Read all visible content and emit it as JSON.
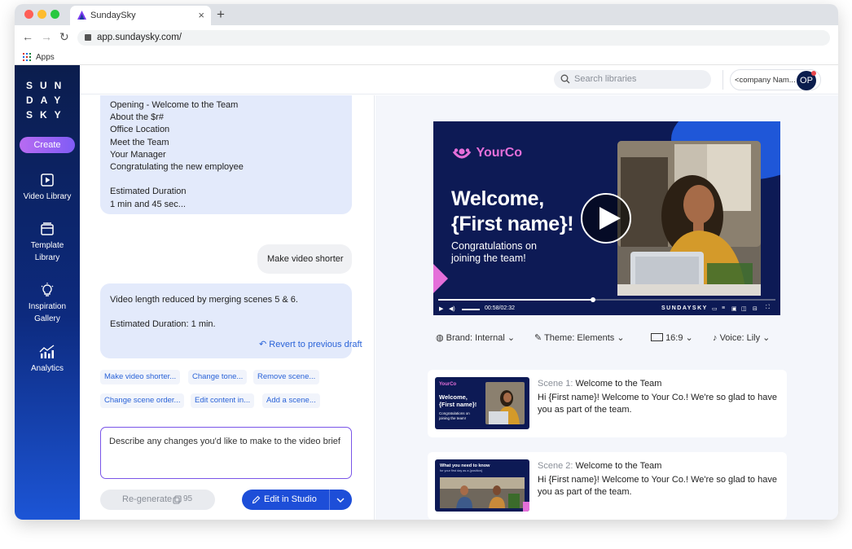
{
  "browser": {
    "tab_title": "SundaySky",
    "url": "app.sundaysky.com/",
    "bookmark_label": "Apps"
  },
  "sidebar": {
    "logo_lines": [
      "SUN",
      "DAY",
      "SKY"
    ],
    "create_label": "Create",
    "items": [
      {
        "label": "Video Library",
        "icon": "play-square-icon"
      },
      {
        "label": "Template Library",
        "icon": "template-icon"
      },
      {
        "label": "Inspiration Gallery",
        "icon": "lightbulb-icon"
      },
      {
        "label": "Analytics",
        "icon": "analytics-icon"
      }
    ]
  },
  "topbar": {
    "search_placeholder": "Search libraries",
    "company_name": "<company Nam...",
    "avatar_initials": "OP"
  },
  "chat": {
    "brief_lines": [
      "Opening - Welcome to the Team",
      "About the $r#",
      "Office Location",
      "Meet the Team",
      "Your Manager",
      "Congratulating the new employee",
      "",
      "Estimated Duration",
      "1 min and 45 sec..."
    ],
    "user_message": "Make video shorter",
    "reply_line1": "Video length reduced by merging scenes 5 & 6.",
    "reply_line2": "Estimated Duration: 1 min.",
    "revert_label": "Revert to previous draft",
    "suggestions": [
      "Make video shorter...",
      "Change tone...",
      "Remove scene...",
      "Change scene order...",
      "Edit content in...",
      "Add a scene..."
    ],
    "input_placeholder": "Describe any changes you'd like to make to the video brief",
    "regenerate_label": "Re-generate",
    "credits": "95",
    "edit_label": "Edit in Studio"
  },
  "player": {
    "brand": "YourCo",
    "headline1": "Welcome,",
    "headline2": "{First name}!",
    "sub1": "Congratulations on",
    "sub2": "joining the team!",
    "time": "00:58/02:32",
    "watermark": "SUNDAYSKY",
    "progress": 0.46
  },
  "options": {
    "brand": "Brand: Internal",
    "theme": "Theme: Elements",
    "ratio": "16:9",
    "voice": "Voice: Lily"
  },
  "scenes": [
    {
      "number": "Scene 1:",
      "title": "Welcome to the Team",
      "text": "Hi {First name}! Welcome to Your Co.! We're so glad to have you as part of the team.",
      "thumb_brand": "YourCo",
      "thumb_headline": "Welcome, {First name}!",
      "thumb_sub": "Congratulations on joining the team!"
    },
    {
      "number": "Scene 2:",
      "title": "Welcome to the Team",
      "text": "Hi {First name}! Welcome to Your Co.! We're so glad to have you as part of the team.",
      "thumb_headline": "What you need to know",
      "thumb_sub": "for your first day as a {position}"
    }
  ],
  "colors": {
    "sidebar_top": "#0b1d4d",
    "sidebar_bottom": "#1c55d6",
    "accent_blue": "#1d4ed8",
    "bubble_bg": "#e3eafb",
    "player_bg": "#0d1a55",
    "brand_pink": "#e46fd9"
  }
}
